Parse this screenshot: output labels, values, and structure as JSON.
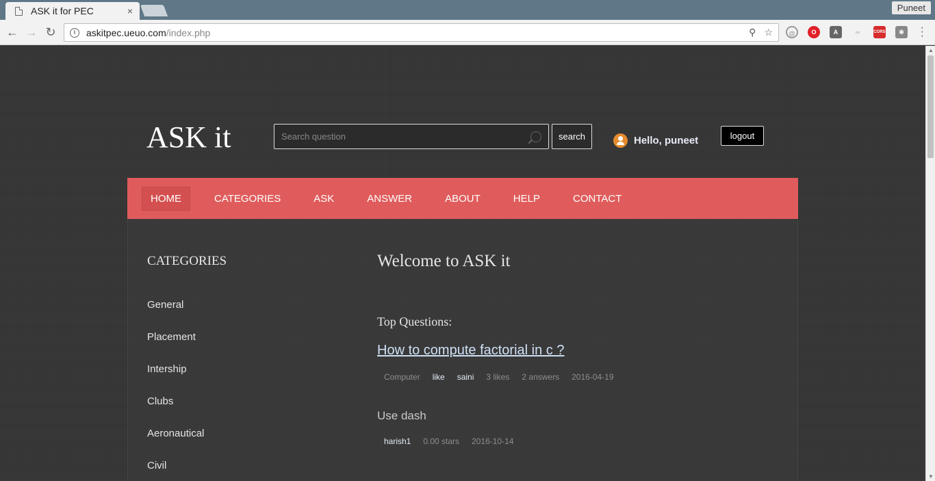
{
  "browser": {
    "tab_title": "ASK it for PEC",
    "tab_close": "×",
    "user_name": "Puneet",
    "url_host": "askitpec.ueuo.com",
    "url_path": "/index.php"
  },
  "header": {
    "site_title": "ASK it",
    "search_placeholder": "Search question",
    "search_button": "search",
    "greeting": "Hello, puneet",
    "logout_button": "logout"
  },
  "nav": {
    "items": [
      "HOME",
      "CATEGORIES",
      "ASK",
      "ANSWER",
      "ABOUT",
      "HELP",
      "CONTACT"
    ],
    "active": "HOME"
  },
  "sidebar": {
    "heading": "CATEGORIES",
    "categories": [
      "General",
      "Placement",
      "Intership",
      "Clubs",
      "Aeronautical",
      "Civil"
    ]
  },
  "main": {
    "welcome": "Welcome to ASK it",
    "top_questions_label": "Top Questions:",
    "questions": [
      {
        "title": "How to compute factorial in c ?",
        "category": "Computer",
        "action": "like",
        "author": "saini",
        "likes": "3 likes",
        "answers": "2 answers",
        "date": "2016-04-19"
      },
      {
        "title": "Use dash",
        "author": "harish1",
        "stars": "0.00 stars",
        "date": "2016-10-14"
      }
    ]
  },
  "colors": {
    "navbar": "#e05c5c",
    "nav_active": "#d45050",
    "avatar": "#e68a2e"
  }
}
